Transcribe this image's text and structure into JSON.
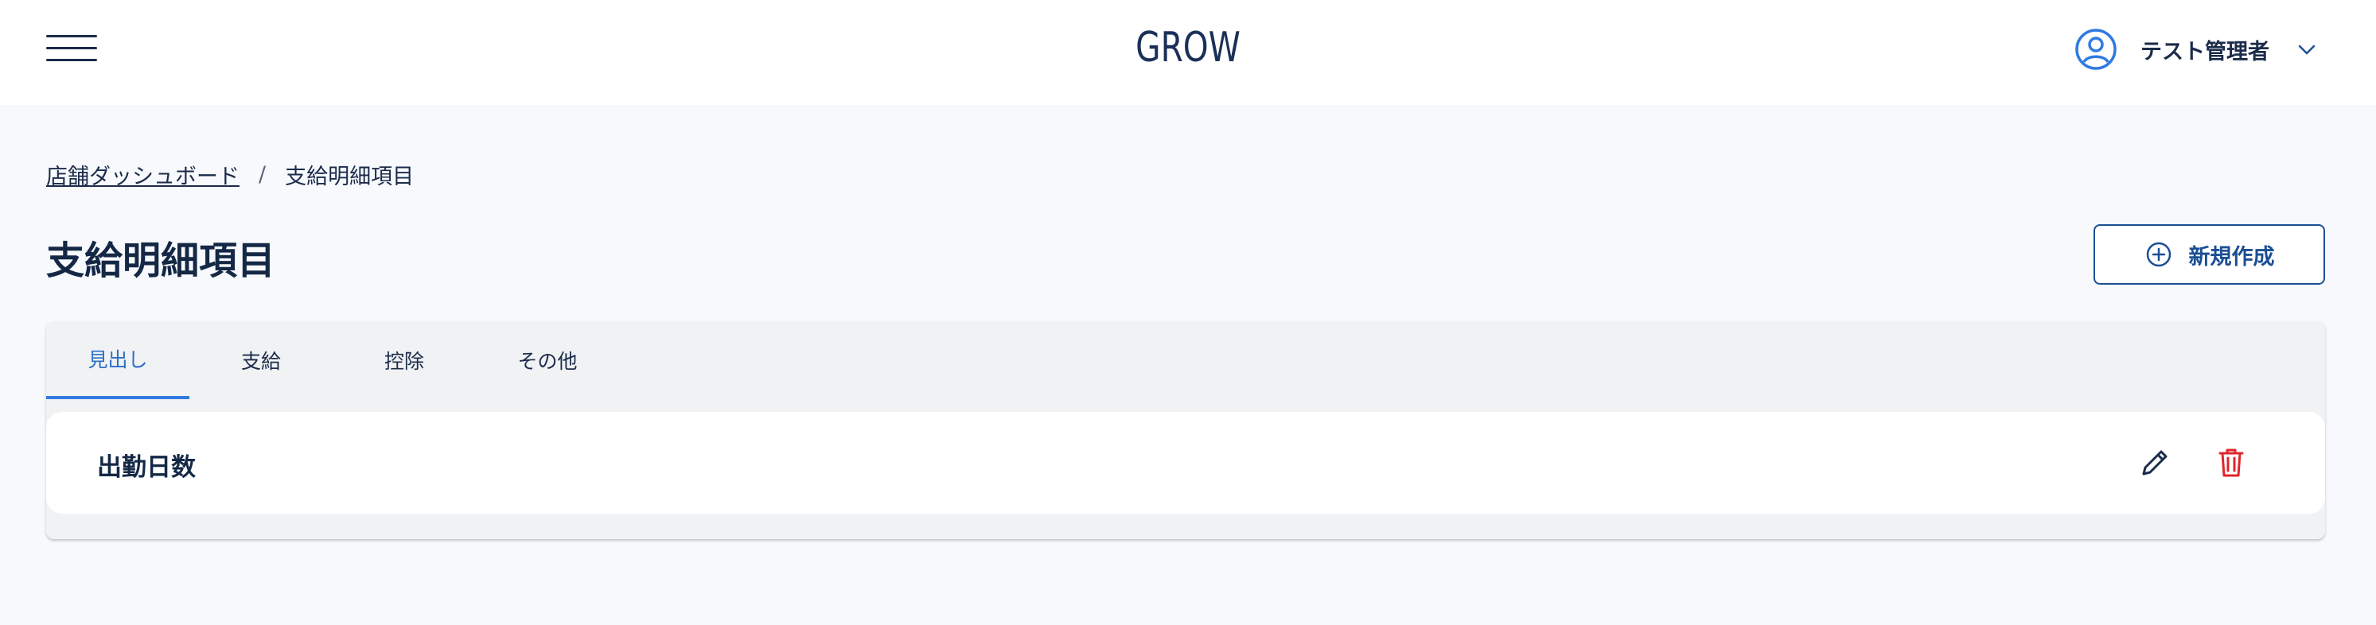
{
  "header": {
    "brand": "GROW",
    "user_name": "テスト管理者"
  },
  "breadcrumb": {
    "parent": "店舗ダッシュボード",
    "separator": "/",
    "current": "支給明細項目"
  },
  "page": {
    "title": "支給明細項目",
    "new_button_label": "新規作成"
  },
  "tabs": [
    {
      "label": "見出し",
      "active": true
    },
    {
      "label": "支給",
      "active": false
    },
    {
      "label": "控除",
      "active": false
    },
    {
      "label": "その他",
      "active": false
    }
  ],
  "items": [
    {
      "name": "出勤日数"
    }
  ],
  "icons": {
    "menu": "hamburger-menu-icon",
    "user": "user-circle-icon",
    "dropdown": "chevron-down-icon",
    "add": "plus-circle-icon",
    "edit": "pencil-icon",
    "delete": "trash-icon"
  },
  "colors": {
    "accent": "#1a4f94",
    "tab_active": "#2f7ae0",
    "delete": "#e0262b",
    "background": "#f7f9fc"
  }
}
